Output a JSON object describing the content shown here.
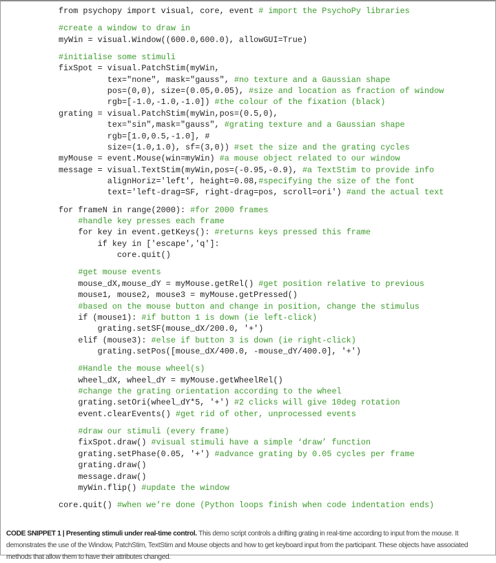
{
  "code_lines": [
    {
      "code": "from psychopy import visual, core, event ",
      "comment": "# import the PsychoPy libraries"
    },
    {
      "code": "",
      "comment": ""
    },
    {
      "code": "",
      "comment": "#create a window to draw in"
    },
    {
      "code": "myWin = visual.Window((600.0,600.0), allowGUI=True)",
      "comment": ""
    },
    {
      "code": "",
      "comment": ""
    },
    {
      "code": "",
      "comment": "#initialise some stimuli"
    },
    {
      "code": "fixSpot = visual.PatchStim(myWin,",
      "comment": ""
    },
    {
      "code": "          tex=\"none\", mask=\"gauss\", ",
      "comment": "#no texture and a Gaussian shape"
    },
    {
      "code": "          pos=(0,0), size=(0.05,0.05), ",
      "comment": "#size and location as fraction of window"
    },
    {
      "code": "          rgb=[-1.0,-1.0,-1.0]) ",
      "comment": "#the colour of the fixation (black)"
    },
    {
      "code": "grating = visual.PatchStim(myWin,pos=(0.5,0),",
      "comment": ""
    },
    {
      "code": "          tex=\"sin\",mask=\"gauss\", ",
      "comment": "#grating texture and a Gaussian shape"
    },
    {
      "code": "          rgb=[1.0,0.5,-1.0], #",
      "comment": ""
    },
    {
      "code": "          size=(1.0,1.0), sf=(3,0)) ",
      "comment": "#set the size and the grating cycles"
    },
    {
      "code": "myMouse = event.Mouse(win=myWin) ",
      "comment": "#a mouse object related to our window"
    },
    {
      "code": "message = visual.TextStim(myWin,pos=(-0.95,-0.9), ",
      "comment": "#a TextStim to provide info"
    },
    {
      "code": "          alignHoriz='left', height=0.08,",
      "comment": "#specifying the size of the font"
    },
    {
      "code": "          text='left-drag=SF, right-drag=pos, scroll=ori') ",
      "comment": "#and the actual text"
    },
    {
      "code": "",
      "comment": ""
    },
    {
      "code": "for frameN in range(2000): ",
      "comment": "#for 2000 frames"
    },
    {
      "code": "    ",
      "comment": "#handle key presses each frame"
    },
    {
      "code": "    for key in event.getKeys(): ",
      "comment": "#returns keys pressed this frame"
    },
    {
      "code": "        if key in ['escape','q']:",
      "comment": ""
    },
    {
      "code": "            core.quit()",
      "comment": ""
    },
    {
      "code": "",
      "comment": ""
    },
    {
      "code": "    ",
      "comment": "#get mouse events"
    },
    {
      "code": "    mouse_dX,mouse_dY = myMouse.getRel() ",
      "comment": "#get position relative to previous"
    },
    {
      "code": "    mouse1, mouse2, mouse3 = myMouse.getPressed()",
      "comment": ""
    },
    {
      "code": "    ",
      "comment": "#based on the mouse button and change in position, change the stimulus"
    },
    {
      "code": "    if (mouse1): ",
      "comment": "#if button 1 is down (ie left-click)"
    },
    {
      "code": "        grating.setSF(mouse_dX/200.0, '+')",
      "comment": ""
    },
    {
      "code": "    elif (mouse3): ",
      "comment": "#else if button 3 is down (ie right-click)"
    },
    {
      "code": "        grating.setPos([mouse_dX/400.0, -mouse_dY/400.0], '+')",
      "comment": ""
    },
    {
      "code": "",
      "comment": ""
    },
    {
      "code": "    ",
      "comment": "#Handle the mouse wheel(s)"
    },
    {
      "code": "    wheel_dX, wheel_dY = myMouse.getWheelRel()",
      "comment": ""
    },
    {
      "code": "    ",
      "comment": "#change the grating orientation according to the wheel"
    },
    {
      "code": "    grating.setOri(wheel_dY*5, '+') ",
      "comment": "#2 clicks will give 10deg rotation"
    },
    {
      "code": "    event.clearEvents() ",
      "comment": "#get rid of other, unprocessed events"
    },
    {
      "code": "",
      "comment": ""
    },
    {
      "code": "    ",
      "comment": "#draw our stimuli (every frame)"
    },
    {
      "code": "    fixSpot.draw() ",
      "comment": "#visual stimuli have a simple ‘draw’ function"
    },
    {
      "code": "    grating.setPhase(0.05, '+') ",
      "comment": "#advance grating by 0.05 cycles per frame"
    },
    {
      "code": "    grating.draw()",
      "comment": ""
    },
    {
      "code": "    message.draw()",
      "comment": ""
    },
    {
      "code": "    myWin.flip() ",
      "comment": "#update the window"
    },
    {
      "code": "",
      "comment": ""
    },
    {
      "code": "core.quit() ",
      "comment": "#when we’re done (Python loops finish when code indentation ends)"
    }
  ],
  "caption": {
    "label": "CODE SNIPPET 1 | Presenting stimuli under real-time control.",
    "text": " This demo script controls a drifting grating in real-time according to input from the mouse. It demonstrates the use of the Window, PatchStim, TextStim and Mouse objects and how to get keyboard input from the participant. These objects have associated methods that allow them to have their attributes changed."
  },
  "colors": {
    "code": "#222222",
    "comment": "#3c9a2c",
    "border": "#9a9a9a"
  }
}
